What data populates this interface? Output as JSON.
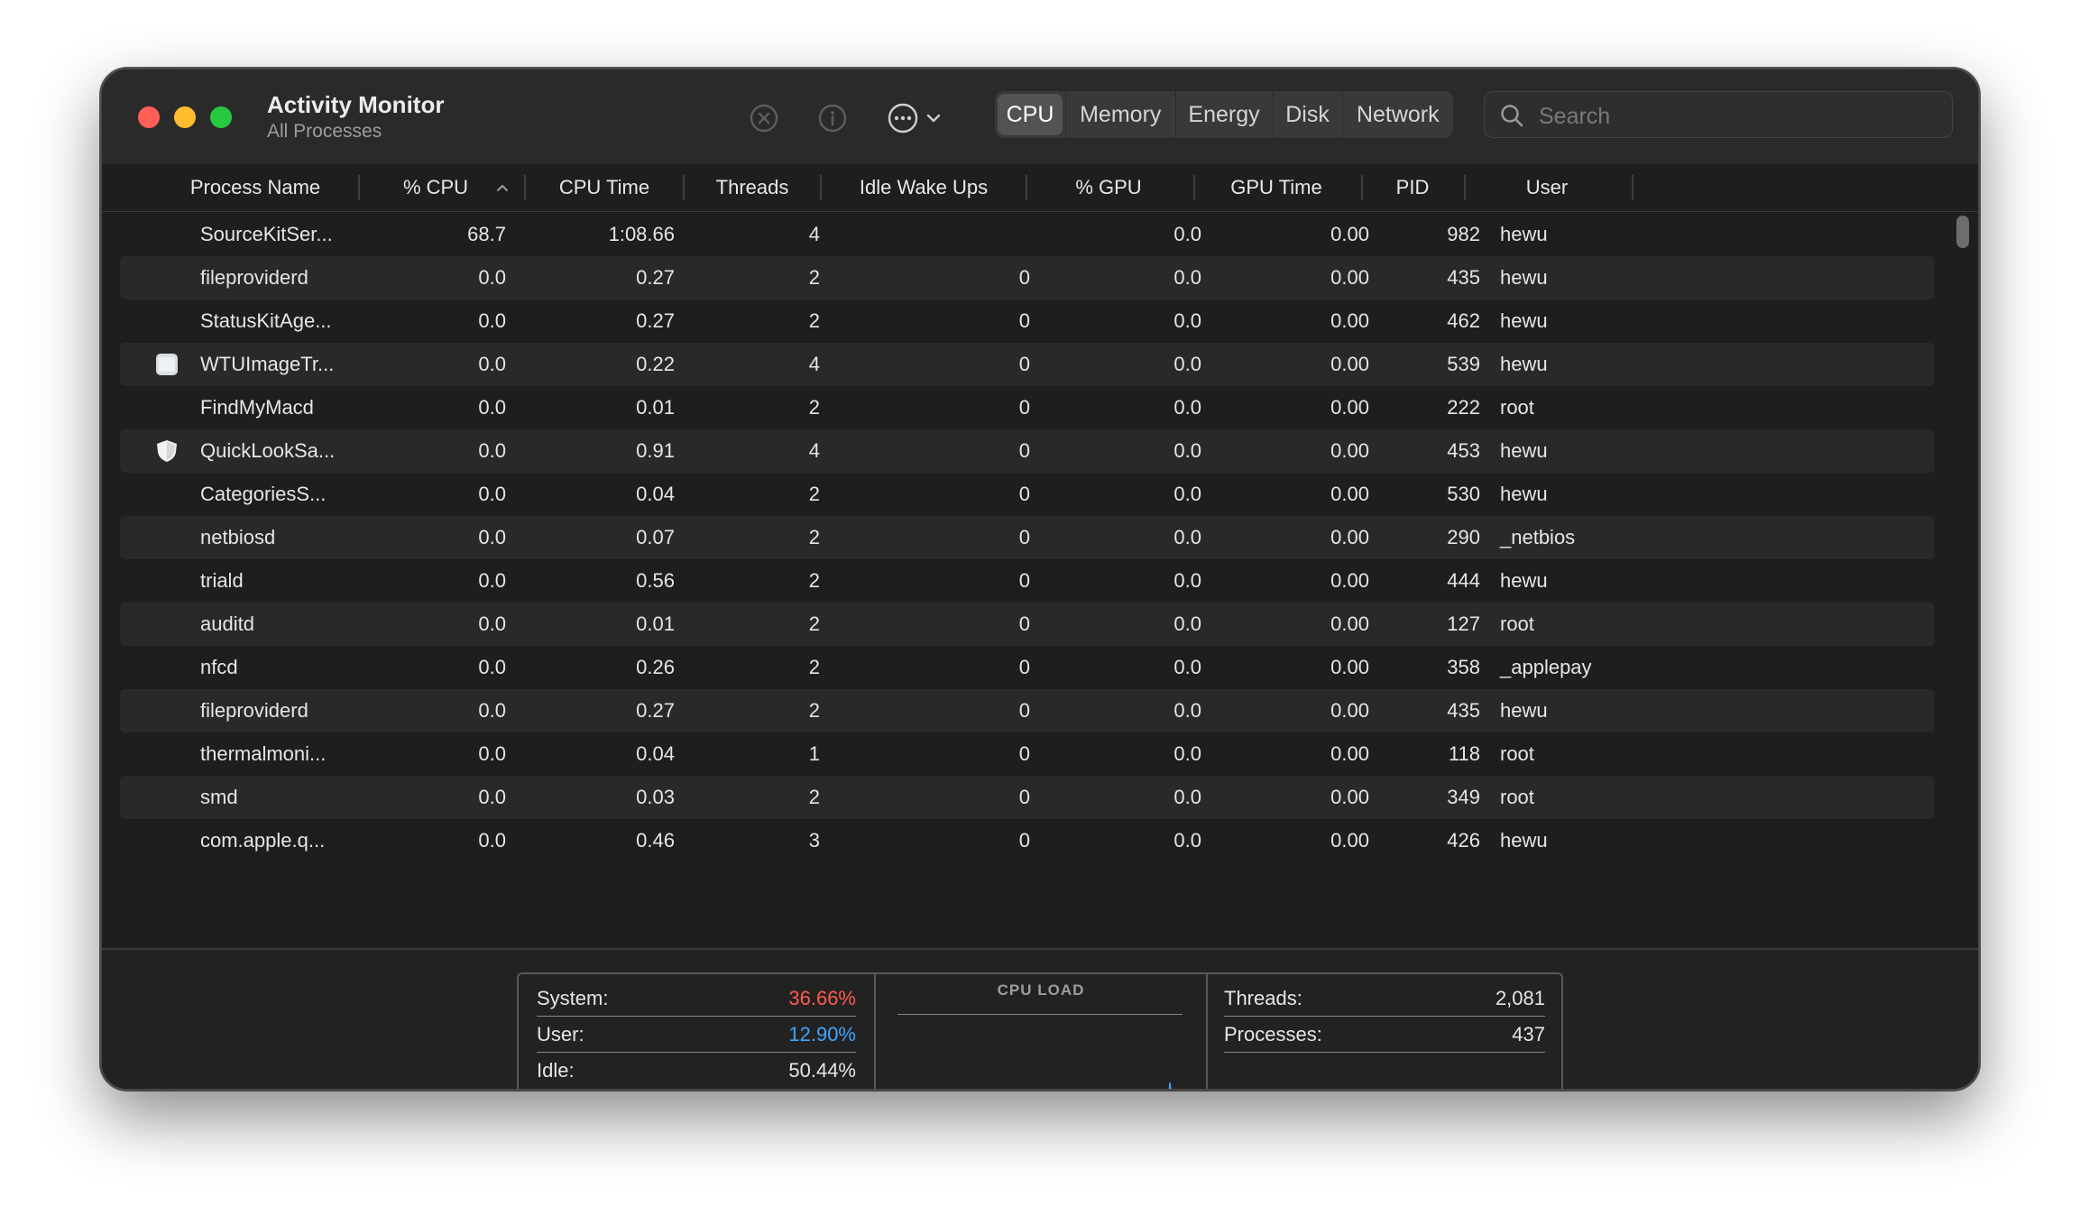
{
  "window": {
    "title": "Activity Monitor",
    "subtitle": "All Processes"
  },
  "toolbar": {
    "stop_icon": "close-circle-icon",
    "info_icon": "info-icon",
    "more_icon": "ellipsis-circle-icon",
    "tabs": [
      "CPU",
      "Memory",
      "Energy",
      "Disk",
      "Network"
    ],
    "active_tab": "CPU",
    "search_placeholder": "Search"
  },
  "columns": [
    "Process Name",
    "% CPU",
    "CPU Time",
    "Threads",
    "Idle Wake Ups",
    "% GPU",
    "GPU Time",
    "PID",
    "User"
  ],
  "sort": {
    "column": "% CPU",
    "direction": "ascending-indicator"
  },
  "processes": [
    {
      "name": "SourceKitSer...",
      "cpu": "68.7",
      "cpu_time": "1:08.66",
      "threads": "4",
      "idle_wake_ups": "",
      "gpu": "0.0",
      "gpu_time": "0.00",
      "pid": "982",
      "user": "hewu",
      "icon": ""
    },
    {
      "name": "fileproviderd",
      "cpu": "0.0",
      "cpu_time": "0.27",
      "threads": "2",
      "idle_wake_ups": "0",
      "gpu": "0.0",
      "gpu_time": "0.00",
      "pid": "435",
      "user": "hewu",
      "icon": ""
    },
    {
      "name": "StatusKitAge...",
      "cpu": "0.0",
      "cpu_time": "0.27",
      "threads": "2",
      "idle_wake_ups": "0",
      "gpu": "0.0",
      "gpu_time": "0.00",
      "pid": "462",
      "user": "hewu",
      "icon": ""
    },
    {
      "name": "WTUImageTr...",
      "cpu": "0.0",
      "cpu_time": "0.22",
      "threads": "4",
      "idle_wake_ups": "0",
      "gpu": "0.0",
      "gpu_time": "0.00",
      "pid": "539",
      "user": "hewu",
      "icon": "app-window-icon"
    },
    {
      "name": "FindMyMacd",
      "cpu": "0.0",
      "cpu_time": "0.01",
      "threads": "2",
      "idle_wake_ups": "0",
      "gpu": "0.0",
      "gpu_time": "0.00",
      "pid": "222",
      "user": "root",
      "icon": ""
    },
    {
      "name": "QuickLookSa...",
      "cpu": "0.0",
      "cpu_time": "0.91",
      "threads": "4",
      "idle_wake_ups": "0",
      "gpu": "0.0",
      "gpu_time": "0.00",
      "pid": "453",
      "user": "hewu",
      "icon": "shield-icon"
    },
    {
      "name": "CategoriesS...",
      "cpu": "0.0",
      "cpu_time": "0.04",
      "threads": "2",
      "idle_wake_ups": "0",
      "gpu": "0.0",
      "gpu_time": "0.00",
      "pid": "530",
      "user": "hewu",
      "icon": ""
    },
    {
      "name": "netbiosd",
      "cpu": "0.0",
      "cpu_time": "0.07",
      "threads": "2",
      "idle_wake_ups": "0",
      "gpu": "0.0",
      "gpu_time": "0.00",
      "pid": "290",
      "user": "_netbios",
      "icon": ""
    },
    {
      "name": "triald",
      "cpu": "0.0",
      "cpu_time": "0.56",
      "threads": "2",
      "idle_wake_ups": "0",
      "gpu": "0.0",
      "gpu_time": "0.00",
      "pid": "444",
      "user": "hewu",
      "icon": ""
    },
    {
      "name": "auditd",
      "cpu": "0.0",
      "cpu_time": "0.01",
      "threads": "2",
      "idle_wake_ups": "0",
      "gpu": "0.0",
      "gpu_time": "0.00",
      "pid": "127",
      "user": "root",
      "icon": ""
    },
    {
      "name": "nfcd",
      "cpu": "0.0",
      "cpu_time": "0.26",
      "threads": "2",
      "idle_wake_ups": "0",
      "gpu": "0.0",
      "gpu_time": "0.00",
      "pid": "358",
      "user": "_applepay",
      "icon": ""
    },
    {
      "name": "fileproviderd",
      "cpu": "0.0",
      "cpu_time": "0.27",
      "threads": "2",
      "idle_wake_ups": "0",
      "gpu": "0.0",
      "gpu_time": "0.00",
      "pid": "435",
      "user": "hewu",
      "icon": ""
    },
    {
      "name": "thermalmoni...",
      "cpu": "0.0",
      "cpu_time": "0.04",
      "threads": "1",
      "idle_wake_ups": "0",
      "gpu": "0.0",
      "gpu_time": "0.00",
      "pid": "118",
      "user": "root",
      "icon": ""
    },
    {
      "name": "smd",
      "cpu": "0.0",
      "cpu_time": "0.03",
      "threads": "2",
      "idle_wake_ups": "0",
      "gpu": "0.0",
      "gpu_time": "0.00",
      "pid": "349",
      "user": "root",
      "icon": ""
    },
    {
      "name": "com.apple.q...",
      "cpu": "0.0",
      "cpu_time": "0.46",
      "threads": "3",
      "idle_wake_ups": "0",
      "gpu": "0.0",
      "gpu_time": "0.00",
      "pid": "426",
      "user": "hewu",
      "icon": ""
    }
  ],
  "footer": {
    "system_label": "System:",
    "system_value": "36.66%",
    "user_label": "User:",
    "user_value": "12.90%",
    "idle_label": "Idle:",
    "idle_value": "50.44%",
    "cpu_load_title": "CPU LOAD",
    "threads_label": "Threads:",
    "threads_value": "2,081",
    "processes_label": "Processes:",
    "processes_value": "437"
  },
  "colors": {
    "system": "#ff5b4f",
    "user": "#3ea6ff",
    "idle": "#e6e6e6",
    "graph_user": "#3ea6ff",
    "graph_system": "#ff5b4f"
  }
}
